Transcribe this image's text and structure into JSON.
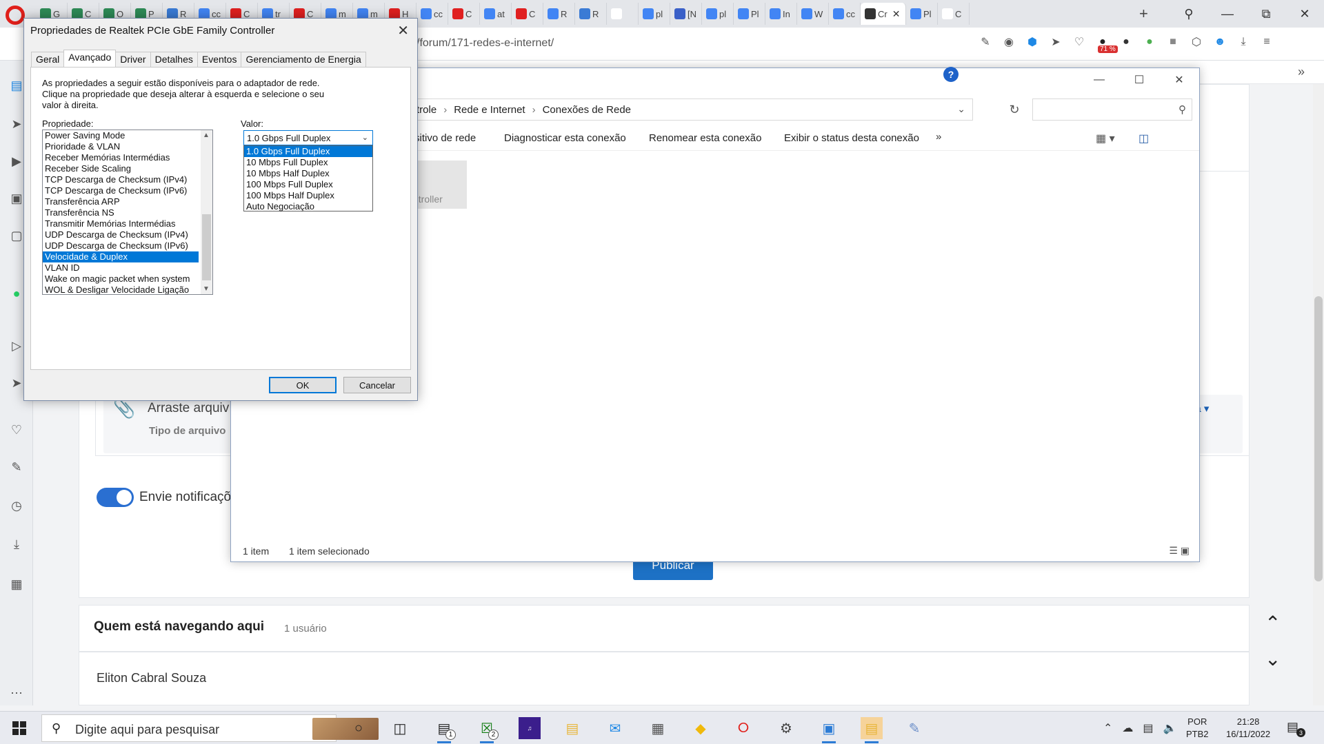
{
  "browser": {
    "tabs": [
      {
        "label": "G",
        "color": "#2e8b57"
      },
      {
        "label": "C",
        "color": "#2e8b57"
      },
      {
        "label": "O",
        "color": "#2e8b57"
      },
      {
        "label": "P",
        "color": "#2e8b57"
      },
      {
        "label": "R",
        "color": "#3a7bd5"
      },
      {
        "label": "cc",
        "color": "#4285f4"
      },
      {
        "label": "C",
        "color": "#e02020"
      },
      {
        "label": "tr",
        "color": "#4285f4"
      },
      {
        "label": "C",
        "color": "#e02020"
      },
      {
        "label": "m",
        "color": "#4285f4"
      },
      {
        "label": "m",
        "color": "#4285f4"
      },
      {
        "label": "H",
        "color": "#e02020"
      },
      {
        "label": "cc",
        "color": "#4285f4"
      },
      {
        "label": "C",
        "color": "#e02020"
      },
      {
        "label": "at",
        "color": "#4285f4"
      },
      {
        "label": "C",
        "color": "#e02020"
      },
      {
        "label": "R",
        "color": "#4285f4"
      },
      {
        "label": "R",
        "color": "#3a7bd5"
      },
      {
        "label": "",
        "color": "#ffffff"
      },
      {
        "label": "pl",
        "color": "#4285f4"
      },
      {
        "label": "[N",
        "color": "#3a60c8"
      },
      {
        "label": "pl",
        "color": "#4285f4"
      },
      {
        "label": "Pl",
        "color": "#4285f4"
      },
      {
        "label": "In",
        "color": "#4285f4"
      },
      {
        "label": "W",
        "color": "#4285f4"
      },
      {
        "label": "cc",
        "color": "#4285f4"
      },
      {
        "label": "Cr",
        "color": "#333333",
        "active": true
      },
      {
        "label": "Pl",
        "color": "#4285f4"
      },
      {
        "label": "C",
        "color": "#ffffff"
      }
    ],
    "url": "/forum/171-redes-e-internet/",
    "ext_badge": "71 %"
  },
  "forum": {
    "drop_text": "Arraste arquiv",
    "drop_sub": "Tipo de arquivo",
    "dropdown_label": "ia ▾",
    "notify_text": "Envie notificaçõ",
    "publish": "Publicar",
    "who_title": "Quem está navegando aqui",
    "who_count": "1 usuário",
    "who_user": "Eliton Cabral Souza"
  },
  "explorer": {
    "crumbs": [
      "trole",
      "Rede e Internet",
      "Conexões de Rede"
    ],
    "commands": [
      "sitivo de rede",
      "Diagnosticar esta conexão",
      "Renomear esta conexão",
      "Exibir o status desta conexão"
    ],
    "more": "»",
    "item_label": "ntroller",
    "status_count": "1 item",
    "status_selected": "1 item selecionado"
  },
  "dialog": {
    "title": "Propriedades de Realtek PCIe GbE Family Controller",
    "tabs": [
      "Geral",
      "Avançado",
      "Driver",
      "Detalhes",
      "Eventos",
      "Gerenciamento de Energia"
    ],
    "active_tab": "Avançado",
    "description": "As propriedades a seguir estão disponíveis para o adaptador de rede.\nClique na propriedade que deseja alterar à esquerda e selecione o seu\nvalor à direita.",
    "property_label": "Propriedade:",
    "value_label": "Valor:",
    "properties": [
      "Power Saving Mode",
      "Prioridade & VLAN",
      "Receber Memórias Intermédias",
      "Receber Side Scaling",
      "TCP Descarga de Checksum (IPv4)",
      "TCP Descarga de Checksum (IPv6)",
      "Transferência ARP",
      "Transferência NS",
      "Transmitir Memórias Intermédias",
      "UDP Descarga de Checksum (IPv4)",
      "UDP Descarga de Checksum (IPv6)",
      "Velocidade & Duplex",
      "VLAN ID",
      "Wake on magic packet when system",
      "WOL & Desligar Velocidade Ligação"
    ],
    "selected_property": "Velocidade & Duplex",
    "selected_value": "1.0 Gbps Full Duplex",
    "value_options": [
      "1.0 Gbps Full Duplex",
      "10 Mbps Full Duplex",
      "10 Mbps Half Duplex",
      "100 Mbps Full Duplex",
      "100 Mbps Half Duplex",
      "Auto Negociação"
    ],
    "ok": "OK",
    "cancel": "Cancelar"
  },
  "taskbar": {
    "search_placeholder": "Digite aqui para pesquisar",
    "badge_1": "1",
    "badge_2": "2",
    "lang_top": "POR",
    "lang_bottom": "PTB2",
    "time": "21:28",
    "date": "16/11/2022",
    "notif_count": "3"
  },
  "colors": {
    "accent": "#0078d7",
    "opera_red": "#e0201b",
    "publish_blue": "#1d71c5"
  }
}
